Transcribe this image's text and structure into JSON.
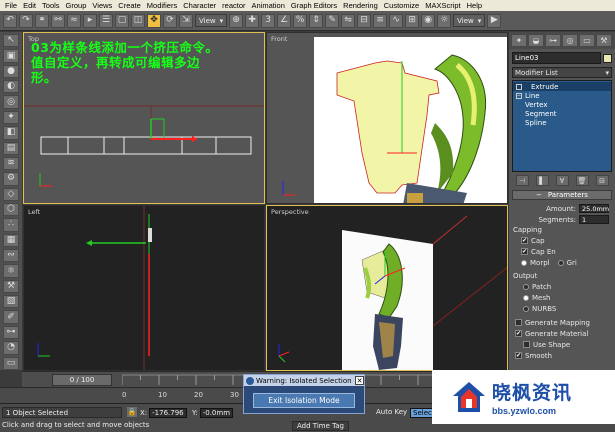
{
  "menu": [
    "File",
    "Edit",
    "Tools",
    "Group",
    "Views",
    "Create",
    "Modifiers",
    "Character",
    "reactor",
    "Animation",
    "Graph Editors",
    "Rendering",
    "Customize",
    "MAXScript",
    "Help"
  ],
  "toolbar": {
    "view1": "View",
    "view2": "View"
  },
  "viewports": {
    "top": "Top",
    "front": "Front",
    "left": "Left",
    "perspective": "Perspective"
  },
  "overlay": {
    "line1": "03为样条线添加一个挤压命令。",
    "line2": "值自定义，再转成可编辑多边",
    "line3": "形。"
  },
  "command_panel": {
    "object_name": "Line03",
    "modifier_list": "Modifier List",
    "stack": [
      "Extrude",
      "Line",
      "Vertex",
      "Segment",
      "Spline"
    ],
    "parameters_title": "Parameters",
    "amount_label": "Amount:",
    "amount_value": "25.0mm",
    "segments_label": "Segments:",
    "segments_value": "1",
    "capping_label": "Capping",
    "cap_start": "Cap",
    "cap_end": "Cap En",
    "morph": "Morpl",
    "grid": "Gri",
    "output_label": "Output",
    "patch": "Patch",
    "mesh": "Mesh",
    "nurbs": "NURBS",
    "gen_mapping": "Generate Mapping",
    "gen_material": "Generate Material",
    "use_shape": "Use Shape",
    "smooth": "Smooth"
  },
  "trackbar": {
    "frame": "0 / 100",
    "ticks": [
      "0",
      "10",
      "20",
      "30",
      "40",
      "50",
      "60",
      "70",
      "80",
      "90"
    ]
  },
  "status": {
    "selected": "1 Object Selected",
    "hint": "Click and drag to select and move objects",
    "x_value": "-176.796",
    "y_value": "-0.0mm",
    "add_time_tag": "Add Time Tag",
    "auto_key": "Auto Key",
    "set_key": "Selec"
  },
  "dialog": {
    "title": "Warning: Isolated Selection",
    "button": "Exit Isolation Mode"
  },
  "watermark": {
    "title": "晓枫资讯",
    "url": "bbs.yzwlo.com"
  }
}
